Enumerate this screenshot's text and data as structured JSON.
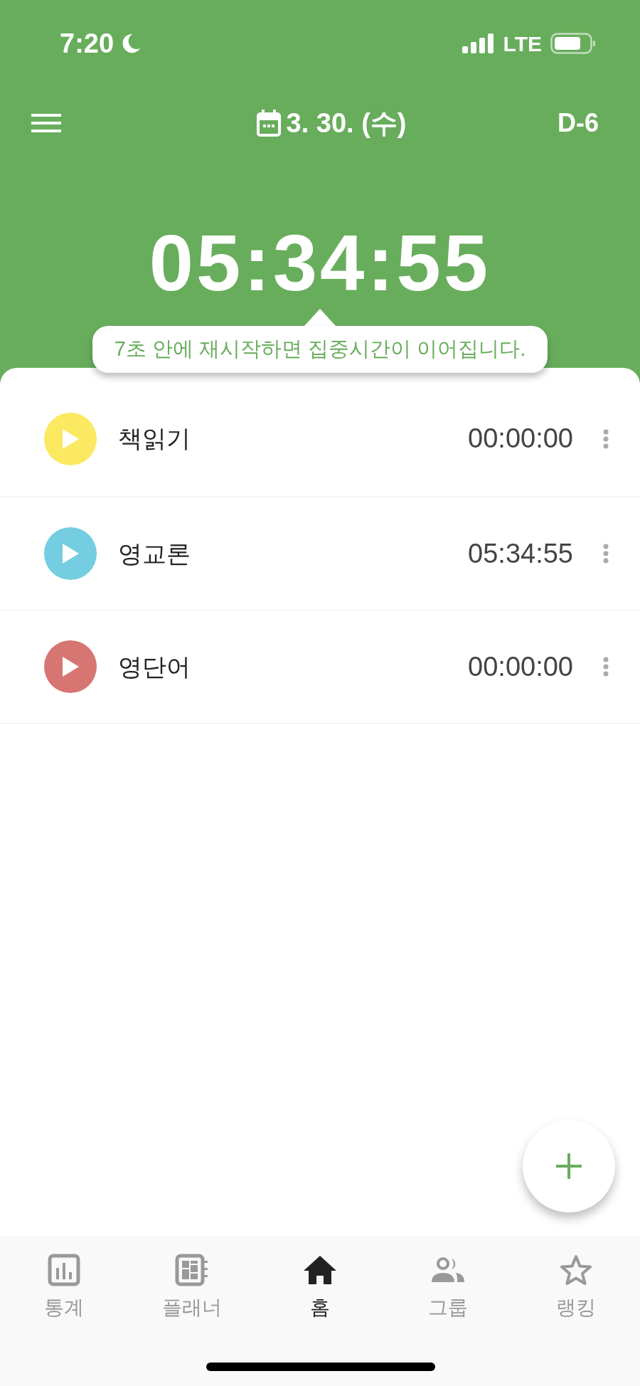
{
  "status_bar": {
    "time": "7:20",
    "network": "LTE"
  },
  "header": {
    "date": "3. 30. (수)",
    "d_day": "D-6"
  },
  "timer": "05:34:55",
  "tooltip": "7초 안에 재시작하면 집중시간이 이어집니다.",
  "subjects": [
    {
      "name": "책읽기",
      "time": "00:00:00",
      "color": "#fbe961"
    },
    {
      "name": "영교론",
      "time": "05:34:55",
      "color": "#74cde0"
    },
    {
      "name": "영단어",
      "time": "00:00:00",
      "color": "#d77573"
    }
  ],
  "nav": [
    {
      "kind": "stats",
      "label": "통계",
      "selected": false
    },
    {
      "kind": "planner",
      "label": "플래너",
      "selected": false
    },
    {
      "kind": "home",
      "label": "홈",
      "selected": true
    },
    {
      "kind": "group",
      "label": "그룹",
      "selected": false
    },
    {
      "kind": "ranking",
      "label": "랭킹",
      "selected": false
    }
  ]
}
